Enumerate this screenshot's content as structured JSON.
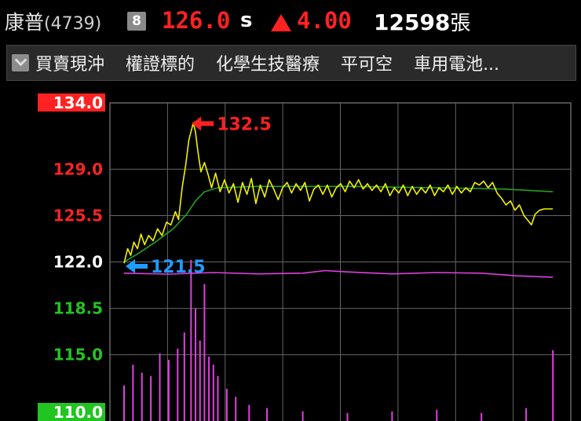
{
  "header": {
    "stock_name": "康普",
    "stock_code": "(4739)",
    "badge": "8",
    "price": "126.0",
    "price_flag": "s",
    "change": "4.00",
    "volume": "12598",
    "volume_unit": "張"
  },
  "tags": [
    "買賣現沖",
    "權證標的",
    "化學生技醫療",
    "平可空",
    "車用電池..."
  ],
  "colors": {
    "up": "#ff2222",
    "down": "#22c422",
    "reference": "#ffffff",
    "price_line": "#f2f200",
    "avg_line": "#22a022",
    "volume": "#e040e0",
    "grid": "#666666",
    "high_anno": "#ff2020",
    "low_anno": "#1e9bff"
  },
  "chart_data": {
    "type": "line",
    "y_ticks": [
      {
        "label": "134.0",
        "value": 134.0,
        "style": "limit-up"
      },
      {
        "label": "129.0",
        "value": 129.0,
        "style": "up"
      },
      {
        "label": "125.5",
        "value": 125.5,
        "style": "up"
      },
      {
        "label": "122.0",
        "value": 122.0,
        "style": "reference"
      },
      {
        "label": "118.5",
        "value": 118.5,
        "style": "down"
      },
      {
        "label": "115.0",
        "value": 115.0,
        "style": "down"
      },
      {
        "label": "110.0",
        "value": 110.0,
        "style": "limit-down"
      }
    ],
    "ylim": [
      110.0,
      134.0
    ],
    "x_divisions": 8,
    "high": {
      "label": "132.5",
      "value": 132.5,
      "x": 0.155
    },
    "low": {
      "label": "121.5",
      "value": 121.5,
      "x": 0.0
    },
    "last_x": 0.96,
    "price_series": [
      [
        0.0,
        121.9
      ],
      [
        0.008,
        123.0
      ],
      [
        0.015,
        122.5
      ],
      [
        0.022,
        123.5
      ],
      [
        0.03,
        123.0
      ],
      [
        0.038,
        124.1
      ],
      [
        0.046,
        123.3
      ],
      [
        0.055,
        124.0
      ],
      [
        0.065,
        123.6
      ],
      [
        0.075,
        124.5
      ],
      [
        0.085,
        124.0
      ],
      [
        0.095,
        125.0
      ],
      [
        0.105,
        124.8
      ],
      [
        0.115,
        125.8
      ],
      [
        0.122,
        125.2
      ],
      [
        0.13,
        127.6
      ],
      [
        0.138,
        129.3
      ],
      [
        0.145,
        131.2
      ],
      [
        0.152,
        132.1
      ],
      [
        0.155,
        132.5
      ],
      [
        0.16,
        131.8
      ],
      [
        0.165,
        130.4
      ],
      [
        0.172,
        128.8
      ],
      [
        0.18,
        129.5
      ],
      [
        0.188,
        128.6
      ],
      [
        0.196,
        127.6
      ],
      [
        0.205,
        128.7
      ],
      [
        0.215,
        127.3
      ],
      [
        0.225,
        128.2
      ],
      [
        0.235,
        127.2
      ],
      [
        0.245,
        127.9
      ],
      [
        0.255,
        126.5
      ],
      [
        0.265,
        128.0
      ],
      [
        0.275,
        127.1
      ],
      [
        0.285,
        128.3
      ],
      [
        0.295,
        126.4
      ],
      [
        0.305,
        127.8
      ],
      [
        0.315,
        126.9
      ],
      [
        0.325,
        128.2
      ],
      [
        0.335,
        127.5
      ],
      [
        0.345,
        126.7
      ],
      [
        0.355,
        127.6
      ],
      [
        0.365,
        128.0
      ],
      [
        0.375,
        127.2
      ],
      [
        0.385,
        127.9
      ],
      [
        0.395,
        127.4
      ],
      [
        0.405,
        128.0
      ],
      [
        0.415,
        126.6
      ],
      [
        0.425,
        127.5
      ],
      [
        0.435,
        127.8
      ],
      [
        0.445,
        127.1
      ],
      [
        0.455,
        127.8
      ],
      [
        0.465,
        126.9
      ],
      [
        0.475,
        127.6
      ],
      [
        0.485,
        127.9
      ],
      [
        0.495,
        127.3
      ],
      [
        0.505,
        128.1
      ],
      [
        0.515,
        127.6
      ],
      [
        0.525,
        128.2
      ],
      [
        0.535,
        127.5
      ],
      [
        0.545,
        127.9
      ],
      [
        0.555,
        127.4
      ],
      [
        0.565,
        127.8
      ],
      [
        0.575,
        127.3
      ],
      [
        0.585,
        127.9
      ],
      [
        0.595,
        127.0
      ],
      [
        0.605,
        127.6
      ],
      [
        0.615,
        127.2
      ],
      [
        0.625,
        127.8
      ],
      [
        0.635,
        127.0
      ],
      [
        0.645,
        127.7
      ],
      [
        0.655,
        127.1
      ],
      [
        0.665,
        127.6
      ],
      [
        0.675,
        127.2
      ],
      [
        0.685,
        127.8
      ],
      [
        0.695,
        127.0
      ],
      [
        0.705,
        127.6
      ],
      [
        0.715,
        127.3
      ],
      [
        0.725,
        127.8
      ],
      [
        0.735,
        127.1
      ],
      [
        0.745,
        127.7
      ],
      [
        0.755,
        127.2
      ],
      [
        0.765,
        127.6
      ],
      [
        0.775,
        127.3
      ],
      [
        0.785,
        128.0
      ],
      [
        0.795,
        127.8
      ],
      [
        0.805,
        128.1
      ],
      [
        0.815,
        127.6
      ],
      [
        0.825,
        128.0
      ],
      [
        0.835,
        127.2
      ],
      [
        0.845,
        126.8
      ],
      [
        0.855,
        126.3
      ],
      [
        0.865,
        126.6
      ],
      [
        0.875,
        125.9
      ],
      [
        0.885,
        126.3
      ],
      [
        0.895,
        125.5
      ],
      [
        0.905,
        125.1
      ],
      [
        0.912,
        124.8
      ],
      [
        0.92,
        125.6
      ],
      [
        0.93,
        125.9
      ],
      [
        0.94,
        126.0
      ],
      [
        0.96,
        126.0
      ]
    ],
    "avg_series": [
      [
        0.0,
        122.0
      ],
      [
        0.03,
        122.6
      ],
      [
        0.07,
        123.5
      ],
      [
        0.11,
        124.5
      ],
      [
        0.14,
        125.6
      ],
      [
        0.16,
        126.6
      ],
      [
        0.18,
        127.3
      ],
      [
        0.21,
        127.6
      ],
      [
        0.3,
        127.7
      ],
      [
        0.5,
        127.7
      ],
      [
        0.7,
        127.6
      ],
      [
        0.85,
        127.5
      ],
      [
        0.96,
        127.3
      ]
    ],
    "secondary_series": [
      [
        0.0,
        121.15
      ],
      [
        0.1,
        121.08
      ],
      [
        0.2,
        121.2
      ],
      [
        0.3,
        121.1
      ],
      [
        0.4,
        121.15
      ],
      [
        0.45,
        121.35
      ],
      [
        0.5,
        121.25
      ],
      [
        0.6,
        121.1
      ],
      [
        0.7,
        121.2
      ],
      [
        0.8,
        121.15
      ],
      [
        0.88,
        120.95
      ],
      [
        0.96,
        120.85
      ]
    ],
    "volume_spikes": [
      [
        0.0,
        0.22
      ],
      [
        0.02,
        0.35
      ],
      [
        0.04,
        0.3
      ],
      [
        0.06,
        0.28
      ],
      [
        0.08,
        0.42
      ],
      [
        0.1,
        0.38
      ],
      [
        0.12,
        0.45
      ],
      [
        0.135,
        0.55
      ],
      [
        0.15,
        1.0
      ],
      [
        0.16,
        0.7
      ],
      [
        0.17,
        0.5
      ],
      [
        0.18,
        0.85
      ],
      [
        0.19,
        0.4
      ],
      [
        0.2,
        0.35
      ],
      [
        0.21,
        0.28
      ],
      [
        0.23,
        0.2
      ],
      [
        0.25,
        0.15
      ],
      [
        0.28,
        0.1
      ],
      [
        0.32,
        0.08
      ],
      [
        0.4,
        0.06
      ],
      [
        0.5,
        0.05
      ],
      [
        0.6,
        0.06
      ],
      [
        0.7,
        0.07
      ],
      [
        0.8,
        0.05
      ],
      [
        0.9,
        0.08
      ],
      [
        0.96,
        0.44
      ]
    ]
  }
}
